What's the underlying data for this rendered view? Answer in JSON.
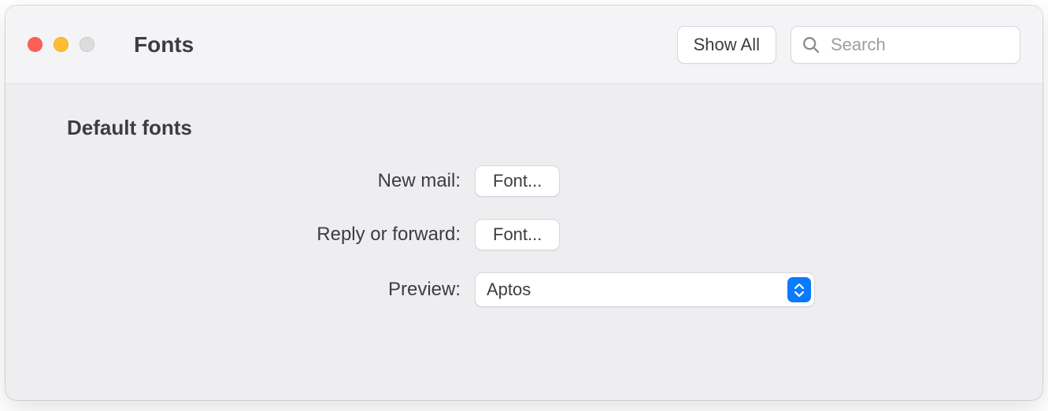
{
  "window": {
    "title": "Fonts"
  },
  "toolbar": {
    "show_all_label": "Show All",
    "search_placeholder": "Search"
  },
  "section": {
    "header": "Default fonts",
    "rows": {
      "new_mail": {
        "label": "New mail:",
        "button": "Font..."
      },
      "reply_forward": {
        "label": "Reply or forward:",
        "button": "Font..."
      },
      "preview": {
        "label": "Preview:",
        "selected": "Aptos"
      }
    }
  }
}
